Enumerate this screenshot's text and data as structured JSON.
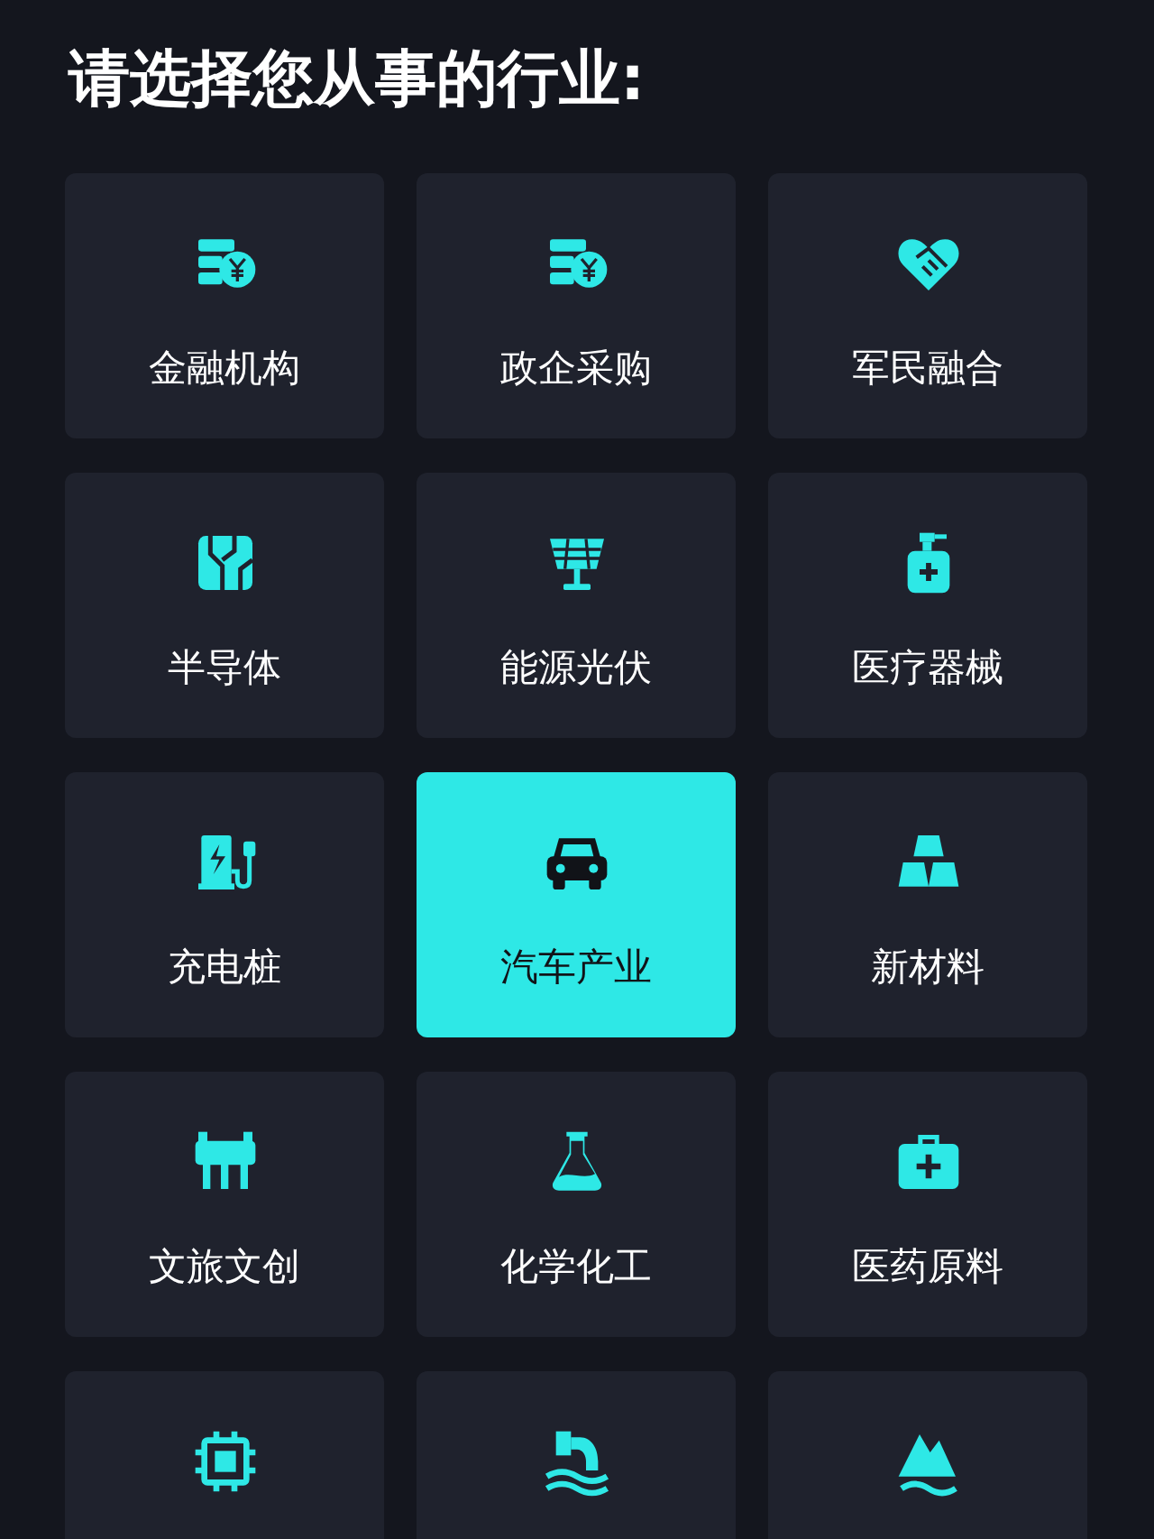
{
  "title": "请选择您从事的行业:",
  "industries": [
    {
      "label": "金融机构",
      "selected": false
    },
    {
      "label": "政企采购",
      "selected": false
    },
    {
      "label": "军民融合",
      "selected": false
    },
    {
      "label": "半导体",
      "selected": false
    },
    {
      "label": "能源光伏",
      "selected": false
    },
    {
      "label": "医疗器械",
      "selected": false
    },
    {
      "label": "充电桩",
      "selected": false
    },
    {
      "label": "汽车产业",
      "selected": true
    },
    {
      "label": "新材料",
      "selected": false
    },
    {
      "label": "文旅文创",
      "selected": false
    },
    {
      "label": "化学化工",
      "selected": false
    },
    {
      "label": "医药原料",
      "selected": false
    },
    {
      "selected": false
    },
    {
      "selected": false
    },
    {
      "selected": false
    }
  ]
}
